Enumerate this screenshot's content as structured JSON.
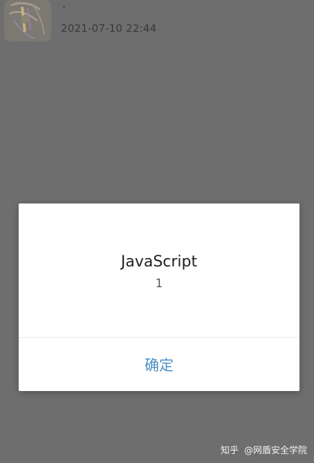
{
  "post": {
    "author": "·",
    "timestamp": "2021-07-10 22:44",
    "avatar_icon": "avatar-image"
  },
  "alert": {
    "title": "JavaScript",
    "message": "1",
    "confirm_label": "确定",
    "confirm_color": "#4a90c8"
  },
  "watermark": {
    "brand": "知乎",
    "account": "@网盾安全学院"
  }
}
